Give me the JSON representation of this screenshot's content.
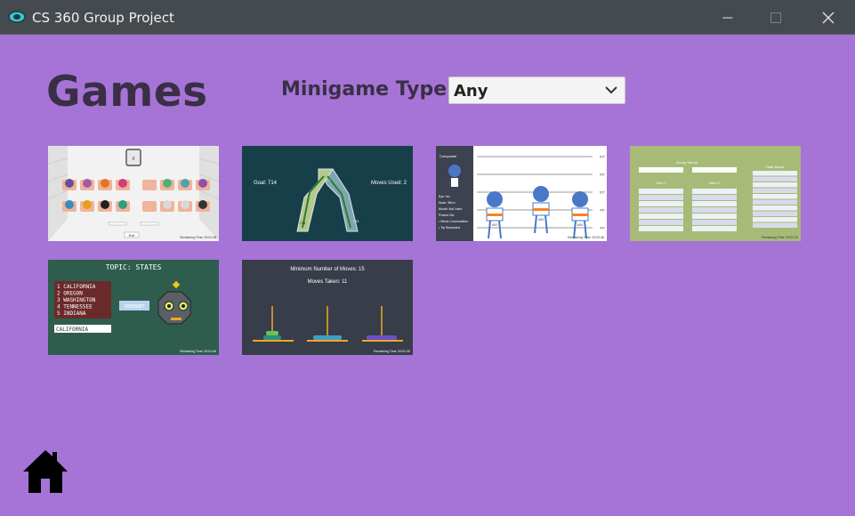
{
  "window": {
    "title": "CS 360 Group Project",
    "controls": [
      "minimize-icon",
      "maximize-icon",
      "close-icon"
    ]
  },
  "header": {
    "title": "Games",
    "filter_label": "Minigame Type:",
    "filter_value": "Any"
  },
  "games": [
    {
      "name": "seating-chart",
      "counter": "0",
      "button": "Exit",
      "timer": "Remaining Time: 00:01:48"
    },
    {
      "name": "river-paths",
      "goal": "Goal: 714",
      "moves": "Moves Used: 2",
      "edge_top": "717",
      "node_left": "714",
      "edge_right": "733"
    },
    {
      "name": "lineup",
      "panel_title": "Composite",
      "traits": [
        "Eye: No",
        "Nose: 38cm",
        "Mouth: Not Used",
        "Posted Via:",
        "• Minus Conversation",
        "• Tip Rewarded"
      ],
      "heights": [
        "6'0\"",
        "5'6\"",
        "5'0\"",
        "4'6\"",
        "4'0\""
      ],
      "suspect_labels": [
        "#02",
        "#03",
        "#04"
      ],
      "timer": "Remaining Time: 00:02:46"
    },
    {
      "name": "word-sort",
      "heading": "Group Words",
      "col1": "Hero 1",
      "col2": "Hero 2",
      "col3": "Final Words",
      "timer": "Remaining Time: 00:01:23"
    },
    {
      "name": "states-quiz",
      "topic": "TOPIC: STATES",
      "states": [
        "1 CALIFORNIA",
        "2 OREGON",
        "3 WASHINGTON",
        "4 TENNESSEE",
        "5 INDIANA"
      ],
      "input": "CALIFORNIA",
      "bubble": "VERMONT",
      "timer": "Remaining Time: 00:01:46"
    },
    {
      "name": "tower-of-hanoi",
      "line1": "Minimum Number of Moves: 15",
      "line2": "Moves Taken: 11",
      "timer": "Remaining Time: 00:01:30"
    }
  ],
  "nav": {
    "home_icon": "home-icon"
  },
  "colors": {
    "background": "#a674d6",
    "titlebar": "#454a4f",
    "heading": "#3a2f46"
  }
}
